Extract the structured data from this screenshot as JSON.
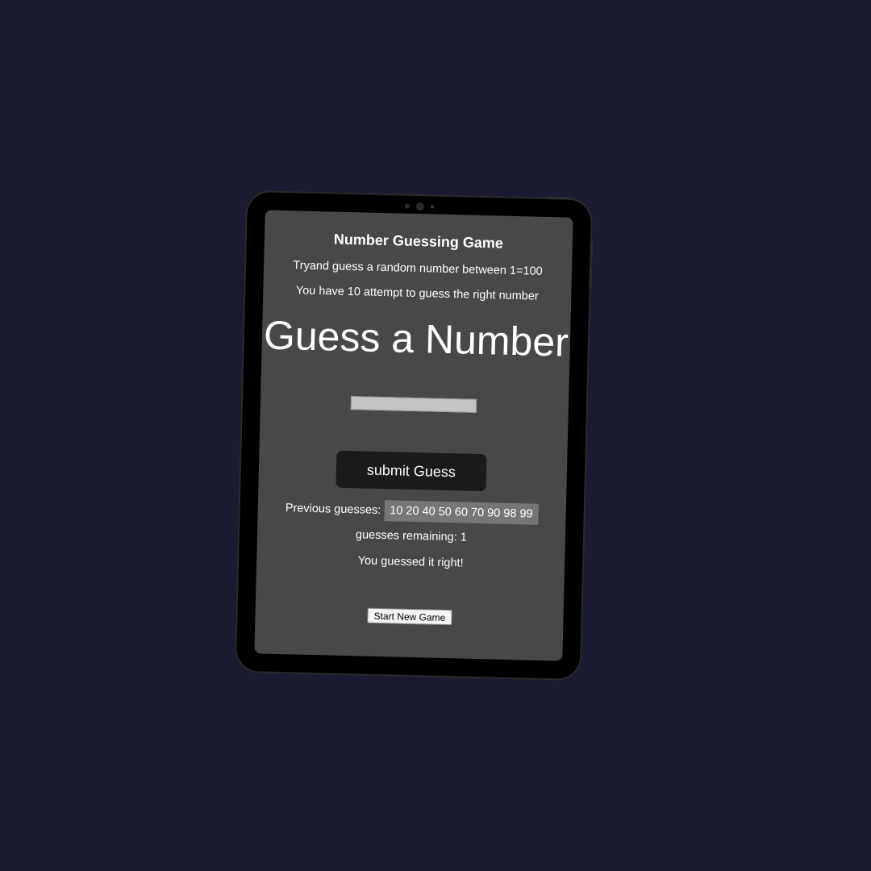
{
  "app": {
    "title": "Number Guessing Game",
    "instruction": "Tryand guess a random number between 1=100",
    "attempts_info": "You have 10 attempt to guess the right number",
    "heading": "Guess a Number"
  },
  "form": {
    "guess_value": "",
    "submit_label": "submit Guess"
  },
  "status": {
    "previous_label": "Previous guesses:",
    "previous_values": "10 20 40 50 60 70 90 98 99",
    "remaining_label": "guesses remaining:",
    "remaining_value": "1",
    "result_message": "You guessed it right!"
  },
  "actions": {
    "new_game_label": "Start New Game"
  },
  "colors": {
    "page_background": "#1b1b2f",
    "screen_background": "#484848",
    "button_background": "#1a1a1a"
  }
}
